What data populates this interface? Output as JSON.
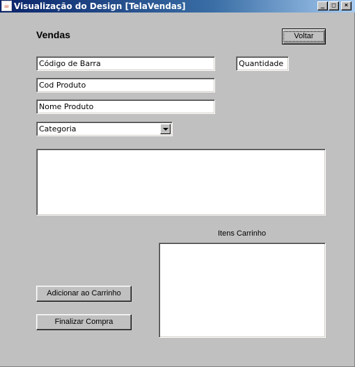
{
  "window": {
    "title": "Visualização do Design [TelaVendas]",
    "icon": "java-cup-icon",
    "controls": {
      "minimize": "_",
      "maximize": "□",
      "close": "×"
    }
  },
  "form": {
    "heading": "Vendas",
    "back_button": "Voltar",
    "barcode_field": "Código de Barra",
    "quantity_field": "Quantidade",
    "product_code_field": "Cod Produto",
    "product_name_field": "Nome Produto",
    "category_select": {
      "selected": "Categoria",
      "icon": "chevron-down-icon"
    },
    "cart_label": "Itens Carrinho",
    "add_to_cart_button": "Adicionar ao Carrinho",
    "finish_purchase_button": "Finalizar Compra"
  },
  "colors": {
    "background": "#c0c0c0",
    "title_bar": "#0a246a",
    "field": "#ffffff"
  }
}
